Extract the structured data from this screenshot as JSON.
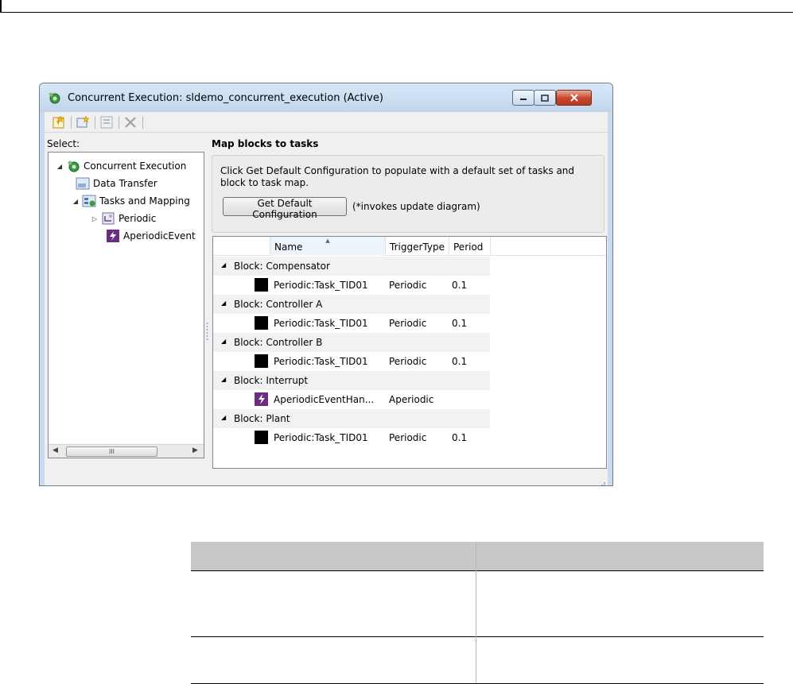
{
  "window": {
    "title": "Concurrent Execution: sldemo_concurrent_execution (Active)"
  },
  "toolbar": {
    "buttons": [
      "add-task-icon",
      "add-trigger-icon",
      "configure-icon",
      "delete-icon"
    ]
  },
  "sidebar": {
    "label": "Select:",
    "items": [
      {
        "label": "Concurrent Execution",
        "icon": "concurrent-execution-icon"
      },
      {
        "label": "Data Transfer",
        "icon": "data-transfer-icon"
      },
      {
        "label": "Tasks and Mapping",
        "icon": "tasks-mapping-icon"
      },
      {
        "label": "Periodic",
        "icon": "periodic-icon"
      },
      {
        "label": "AperiodicEvent",
        "icon": "aperiodic-event-icon"
      }
    ],
    "scroll_thumb": "III"
  },
  "main": {
    "heading": "Map blocks to tasks",
    "info_text": "Click Get Default Configuration to populate with a default set of tasks and block to task map.",
    "default_button": "Get Default Configuration",
    "hint": "(*invokes update diagram)",
    "columns": [
      "Name",
      "TriggerType",
      "Period"
    ],
    "groups": [
      {
        "title": "Block: Compensator",
        "task": "Periodic:Task_TID01",
        "trigger": "Periodic",
        "period": "0.1"
      },
      {
        "title": "Block: Controller A",
        "task": "Periodic:Task_TID01",
        "trigger": "Periodic",
        "period": "0.1"
      },
      {
        "title": "Block: Controller B",
        "task": "Periodic:Task_TID01",
        "trigger": "Periodic",
        "period": "0.1"
      },
      {
        "title": "Block: Interrupt",
        "task": "AperiodicEventHan...",
        "trigger": "Aperiodic",
        "period": ""
      },
      {
        "title": "Block: Plant",
        "task": "Periodic:Task_TID01",
        "trigger": "Periodic",
        "period": "0.1"
      }
    ]
  },
  "colors": {
    "title_bar": "#c9dbee",
    "close_button": "#c8442c",
    "aperiodic_task": "#6b2d80",
    "table_header": "#c8c8c8"
  }
}
